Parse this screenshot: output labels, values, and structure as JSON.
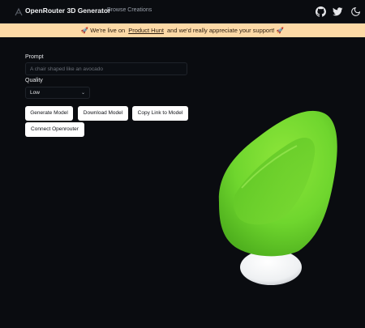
{
  "header": {
    "app_title": "OpenRouter 3D Generator",
    "nav_link": "Browse Creations",
    "icons": [
      "logo-icon",
      "github-icon",
      "twitter-icon",
      "dark-mode-icon"
    ]
  },
  "banner": {
    "text_before": "🚀 We're live on",
    "link_text": "Product Hunt",
    "text_after": "and we'd really appreciate your support! 🚀",
    "background": "#fcd9a6"
  },
  "form": {
    "prompt_label": "Prompt",
    "prompt_value": "",
    "prompt_placeholder": "A chair shaped like an avocado",
    "quality_label": "Quality",
    "quality_value": "Low"
  },
  "actions": {
    "generate_label": "Generate Model",
    "download_label": "Download Model",
    "copy_link_label": "Copy Link to Model",
    "connect_label": "Connect Openrouter"
  },
  "viewer": {
    "model_description_icon": "avocado-chair-model",
    "model_color": "#6fd62e"
  },
  "colors": {
    "page_background": "#0a0c10",
    "button_background": "#ffffff"
  }
}
